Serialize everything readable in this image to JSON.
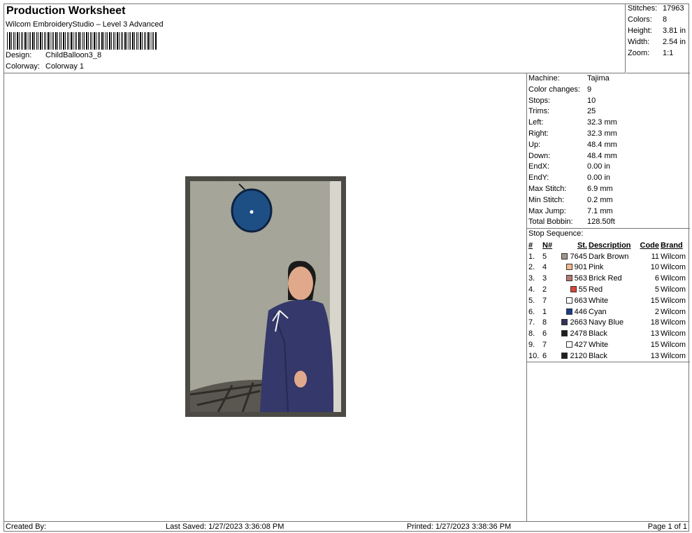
{
  "header": {
    "title": "Production Worksheet",
    "subtitle": "Wilcom EmbroideryStudio – Level 3 Advanced",
    "design_label": "Design:",
    "design_value": "ChildBalloon3_8",
    "colorway_label": "Colorway:",
    "colorway_value": "Colorway 1"
  },
  "stats": [
    {
      "k": "Stitches:",
      "v": "17963"
    },
    {
      "k": "Colors:",
      "v": "8"
    },
    {
      "k": "Height:",
      "v": "3.81 in"
    },
    {
      "k": "Width:",
      "v": "2.54 in"
    },
    {
      "k": "Zoom:",
      "v": "1:1"
    }
  ],
  "machine": [
    {
      "k": "Machine:",
      "v": "Tajima"
    },
    {
      "k": "Color changes:",
      "v": "9"
    },
    {
      "k": "Stops:",
      "v": "10"
    },
    {
      "k": "Trims:",
      "v": "25"
    },
    {
      "k": "Left:",
      "v": "32.3 mm"
    },
    {
      "k": "Right:",
      "v": "32.3 mm"
    },
    {
      "k": "Up:",
      "v": "48.4 mm"
    },
    {
      "k": "Down:",
      "v": "48.4 mm"
    },
    {
      "k": "EndX:",
      "v": "0.00 in"
    },
    {
      "k": "EndY:",
      "v": "0.00 in"
    },
    {
      "k": "Max Stitch:",
      "v": "6.9 mm"
    },
    {
      "k": "Min Stitch:",
      "v": "0.2 mm"
    },
    {
      "k": "Max Jump:",
      "v": "7.1 mm"
    },
    {
      "k": "Total Bobbin:",
      "v": "128.50ft"
    }
  ],
  "sequence": {
    "label": "Stop Sequence:",
    "headers": [
      "#",
      "N#",
      "St.",
      "Description",
      "Code",
      "Brand"
    ],
    "rows": [
      {
        "idx": "1.",
        "n": "5",
        "color": "#a0968c",
        "st": "7645",
        "desc": "Dark Brown",
        "code": "11",
        "brand": "Wilcom"
      },
      {
        "idx": "2.",
        "n": "4",
        "color": "#f2b890",
        "st": "901",
        "desc": "Pink",
        "code": "10",
        "brand": "Wilcom"
      },
      {
        "idx": "3.",
        "n": "3",
        "color": "#b47a74",
        "st": "563",
        "desc": "Brick Red",
        "code": "6",
        "brand": "Wilcom"
      },
      {
        "idx": "4.",
        "n": "2",
        "color": "#dc4638",
        "st": "55",
        "desc": "Red",
        "code": "5",
        "brand": "Wilcom"
      },
      {
        "idx": "5.",
        "n": "7",
        "color": "#ffffff",
        "st": "663",
        "desc": "White",
        "code": "15",
        "brand": "Wilcom"
      },
      {
        "idx": "6.",
        "n": "1",
        "color": "#1a3e8c",
        "st": "446",
        "desc": "Cyan",
        "code": "2",
        "brand": "Wilcom"
      },
      {
        "idx": "7.",
        "n": "8",
        "color": "#32325a",
        "st": "2663",
        "desc": "Navy Blue",
        "code": "18",
        "brand": "Wilcom"
      },
      {
        "idx": "8.",
        "n": "6",
        "color": "#1e1e1e",
        "st": "2478",
        "desc": "Black",
        "code": "13",
        "brand": "Wilcom"
      },
      {
        "idx": "9.",
        "n": "7",
        "color": "#ffffff",
        "st": "427",
        "desc": "White",
        "code": "15",
        "brand": "Wilcom"
      },
      {
        "idx": "10.",
        "n": "6",
        "color": "#1e1e1e",
        "st": "2120",
        "desc": "Black",
        "code": "13",
        "brand": "Wilcom"
      }
    ]
  },
  "footer": {
    "created": "Created By:",
    "saved": "Last Saved: 1/27/2023 3:36:08 PM",
    "printed": "Printed: 1/27/2023 3:38:36 PM",
    "page": "Page 1 of 1"
  }
}
